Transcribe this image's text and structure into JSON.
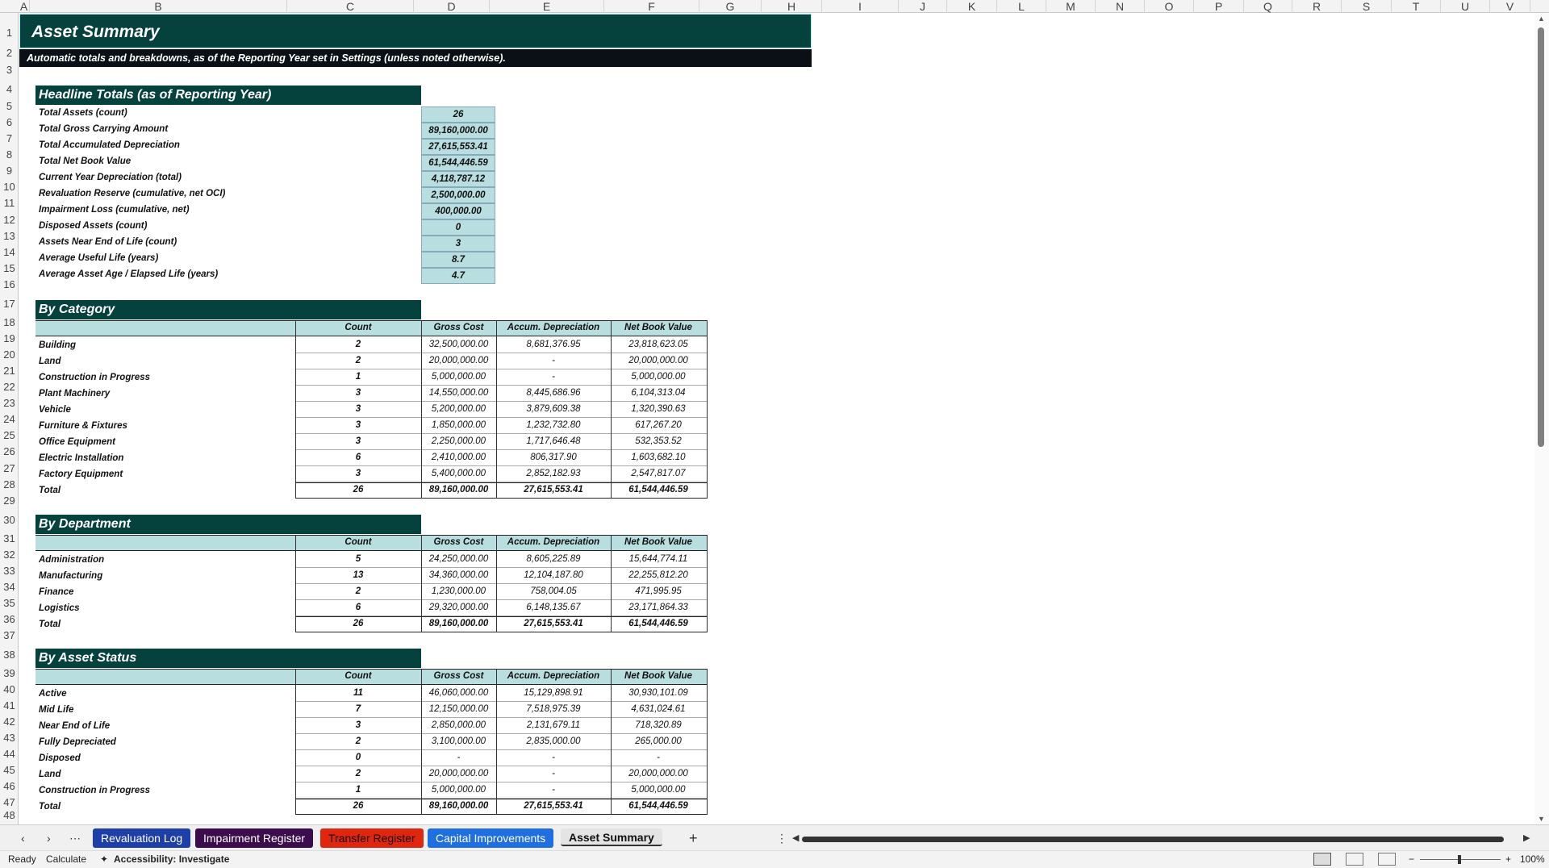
{
  "columns": [
    "A",
    "B",
    "C",
    "D",
    "E",
    "F",
    "G",
    "H",
    "I",
    "J",
    "K",
    "L",
    "M",
    "N",
    "O",
    "P",
    "Q",
    "R",
    "S",
    "T",
    "U",
    "V"
  ],
  "rows": [
    "1",
    "2",
    "3",
    "4",
    "5",
    "6",
    "7",
    "8",
    "9",
    "10",
    "11",
    "12",
    "13",
    "14",
    "15",
    "16",
    "17",
    "18",
    "19",
    "20",
    "21",
    "22",
    "23",
    "24",
    "25",
    "26",
    "27",
    "28",
    "29",
    "30",
    "31",
    "32",
    "33",
    "34",
    "35",
    "36",
    "37",
    "38",
    "39",
    "40",
    "41",
    "42",
    "43",
    "44",
    "45",
    "46",
    "47",
    "48"
  ],
  "title": "Asset Summary",
  "subtitle": "Automatic totals and breakdowns, as of the Reporting Year set in Settings (unless noted otherwise).",
  "headline": {
    "heading": "Headline Totals (as of Reporting Year)",
    "items": [
      {
        "label": "Total Assets (count)",
        "value": "26"
      },
      {
        "label": "Total Gross Carrying Amount",
        "value": "89,160,000.00"
      },
      {
        "label": "Total Accumulated Depreciation",
        "value": "27,615,553.41"
      },
      {
        "label": "Total Net Book Value",
        "value": "61,544,446.59"
      },
      {
        "label": "Current Year Depreciation (total)",
        "value": "4,118,787.12"
      },
      {
        "label": "Revaluation Reserve (cumulative, net OCI)",
        "value": "2,500,000.00"
      },
      {
        "label": "Impairment Loss (cumulative, net)",
        "value": "400,000.00"
      },
      {
        "label": "Disposed Assets (count)",
        "value": "0"
      },
      {
        "label": "Assets Near End of Life (count)",
        "value": "3"
      },
      {
        "label": "Average Useful Life (years)",
        "value": "8.7"
      },
      {
        "label": "Average Asset Age / Elapsed Life (years)",
        "value": "4.7"
      }
    ]
  },
  "table_headers": [
    "Count",
    "Gross Cost",
    "Accum. Depreciation",
    "Net Book Value"
  ],
  "sections": [
    {
      "heading": "By Category",
      "rows": [
        [
          "Building",
          "2",
          "32,500,000.00",
          "8,681,376.95",
          "23,818,623.05"
        ],
        [
          "Land",
          "2",
          "20,000,000.00",
          "-",
          "20,000,000.00"
        ],
        [
          "Construction in Progress",
          "1",
          "5,000,000.00",
          "-",
          "5,000,000.00"
        ],
        [
          "Plant Machinery",
          "3",
          "14,550,000.00",
          "8,445,686.96",
          "6,104,313.04"
        ],
        [
          "Vehicle",
          "3",
          "5,200,000.00",
          "3,879,609.38",
          "1,320,390.63"
        ],
        [
          "Furniture & Fixtures",
          "3",
          "1,850,000.00",
          "1,232,732.80",
          "617,267.20"
        ],
        [
          "Office Equipment",
          "3",
          "2,250,000.00",
          "1,717,646.48",
          "532,353.52"
        ],
        [
          "Electric Installation",
          "6",
          "2,410,000.00",
          "806,317.90",
          "1,603,682.10"
        ],
        [
          "Factory Equipment",
          "3",
          "5,400,000.00",
          "2,852,182.93",
          "2,547,817.07"
        ]
      ],
      "total": [
        "Total",
        "26",
        "89,160,000.00",
        "27,615,553.41",
        "61,544,446.59"
      ]
    },
    {
      "heading": "By Department",
      "rows": [
        [
          "Administration",
          "5",
          "24,250,000.00",
          "8,605,225.89",
          "15,644,774.11"
        ],
        [
          "Manufacturing",
          "13",
          "34,360,000.00",
          "12,104,187.80",
          "22,255,812.20"
        ],
        [
          "Finance",
          "2",
          "1,230,000.00",
          "758,004.05",
          "471,995.95"
        ],
        [
          "Logistics",
          "6",
          "29,320,000.00",
          "6,148,135.67",
          "23,171,864.33"
        ]
      ],
      "total": [
        "Total",
        "26",
        "89,160,000.00",
        "27,615,553.41",
        "61,544,446.59"
      ]
    },
    {
      "heading": "By Asset Status",
      "rows": [
        [
          "Active",
          "11",
          "46,060,000.00",
          "15,129,898.91",
          "30,930,101.09"
        ],
        [
          "Mid Life",
          "7",
          "12,150,000.00",
          "7,518,975.39",
          "4,631,024.61"
        ],
        [
          "Near End of Life",
          "3",
          "2,850,000.00",
          "2,131,679.11",
          "718,320.89"
        ],
        [
          "Fully Depreciated",
          "2",
          "3,100,000.00",
          "2,835,000.00",
          "265,000.00"
        ],
        [
          "Disposed",
          "0",
          "-",
          "-",
          "-"
        ],
        [
          "Land",
          "2",
          "20,000,000.00",
          "-",
          "20,000,000.00"
        ],
        [
          "Construction in Progress",
          "1",
          "5,000,000.00",
          "-",
          "5,000,000.00"
        ]
      ],
      "total": [
        "Total",
        "26",
        "89,160,000.00",
        "27,615,553.41",
        "61,544,446.59"
      ]
    }
  ],
  "tabs": [
    {
      "label": "Revaluation Log",
      "bg": "#1f3fa8",
      "fg": "#ffffff"
    },
    {
      "label": "Impairment Register",
      "bg": "#3b0d4d",
      "fg": "#ffffff"
    },
    {
      "label": "Transfer Register",
      "bg": "#e0260f",
      "fg": "#111111"
    },
    {
      "label": "Capital Improvements",
      "bg": "#1f6fe0",
      "fg": "#ffffff"
    },
    {
      "label": "Asset Summary",
      "bg": "#e4e4e4",
      "fg": "#111111",
      "active": true
    }
  ],
  "tab_nav": {
    "prev": "‹",
    "next": "›",
    "more": "⋯",
    "add": "+",
    "options": "⋮",
    "scroll_left": "◀",
    "scroll_right": "▶"
  },
  "status": {
    "ready": "Ready",
    "calculate": "Calculate",
    "accessibility": "Accessibility: Investigate",
    "zoom": "100%",
    "zoom_minus": "−",
    "zoom_plus": "+"
  },
  "colors": {
    "dark_teal": "#05413d",
    "light_teal": "#b9dedf",
    "subtitle_bg": "#0b1016"
  }
}
